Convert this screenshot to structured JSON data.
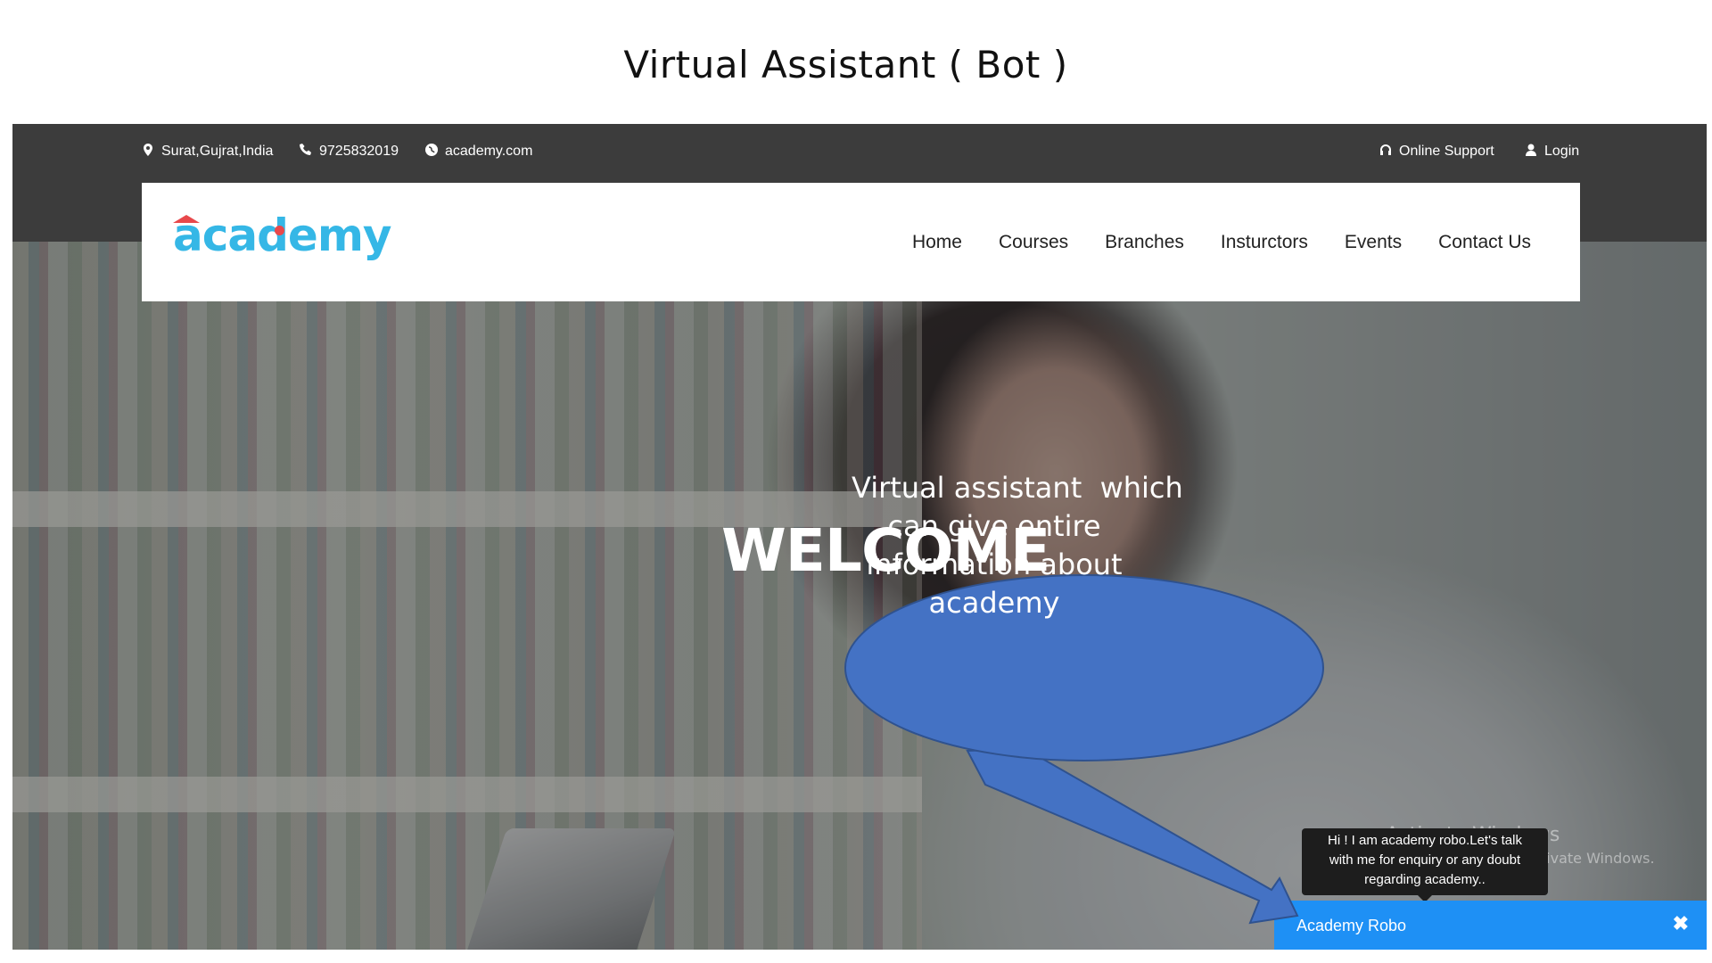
{
  "slide": {
    "title": "Virtual Assistant ( Bot )"
  },
  "topbar": {
    "location": "Surat,Gujrat,India",
    "phone": "9725832019",
    "website": "academy.com",
    "online_support": "Online Support",
    "login": "Login",
    "icons": {
      "location": "map-pin-icon",
      "phone": "phone-icon",
      "website": "globe-icon",
      "support": "headset-icon",
      "login": "user-icon"
    }
  },
  "navbar": {
    "logo_text": "academy",
    "items": [
      "Home",
      "Courses",
      "Branches",
      "Insturctors",
      "Events",
      "Contact Us"
    ]
  },
  "hero": {
    "heading": "WELCOME"
  },
  "callout": {
    "lines": [
      "Virtual assistant  which",
      "can give entire",
      "information about",
      "academy"
    ],
    "color": "#4472c4"
  },
  "chat": {
    "tooltip_lines": [
      "Hi ! I am academy robo.Let's talk",
      "with me for enquiry or any doubt",
      "regarding academy.."
    ],
    "bar_title": "Academy Robo",
    "close_icon": "close-icon",
    "bar_color": "#1e90f5"
  },
  "watermark": {
    "line1": "Activate Windows",
    "line2": "Go to Settings to activate Windows."
  }
}
